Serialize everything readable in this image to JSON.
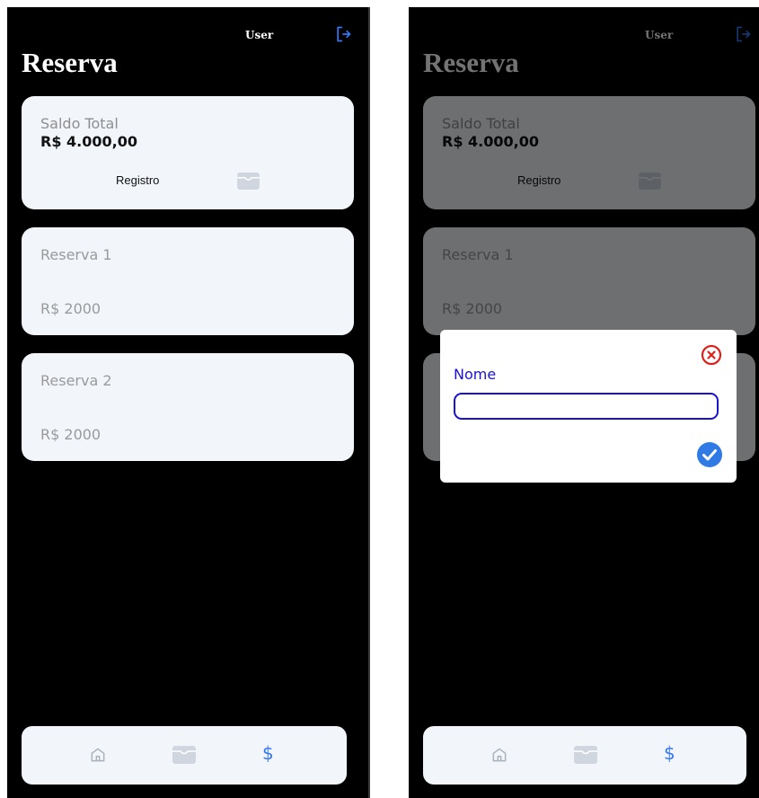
{
  "header": {
    "user_label": "User",
    "title": "Reserva"
  },
  "saldo": {
    "label": "Saldo Total",
    "value": "R$ 4.000,00",
    "registro_label": "Registro"
  },
  "reservas": [
    {
      "name": "Reserva 1",
      "value": "R$ 2000"
    },
    {
      "name": "Reserva 2",
      "value": "R$ 2000"
    }
  ],
  "nav": {
    "money_symbol": "$"
  },
  "modal": {
    "label": "Nome",
    "input_value": ""
  },
  "colors": {
    "accent": "#3478f6",
    "modal_text": "#1a12cf",
    "close": "#e0201b",
    "card_bg": "#f2f6fb"
  }
}
